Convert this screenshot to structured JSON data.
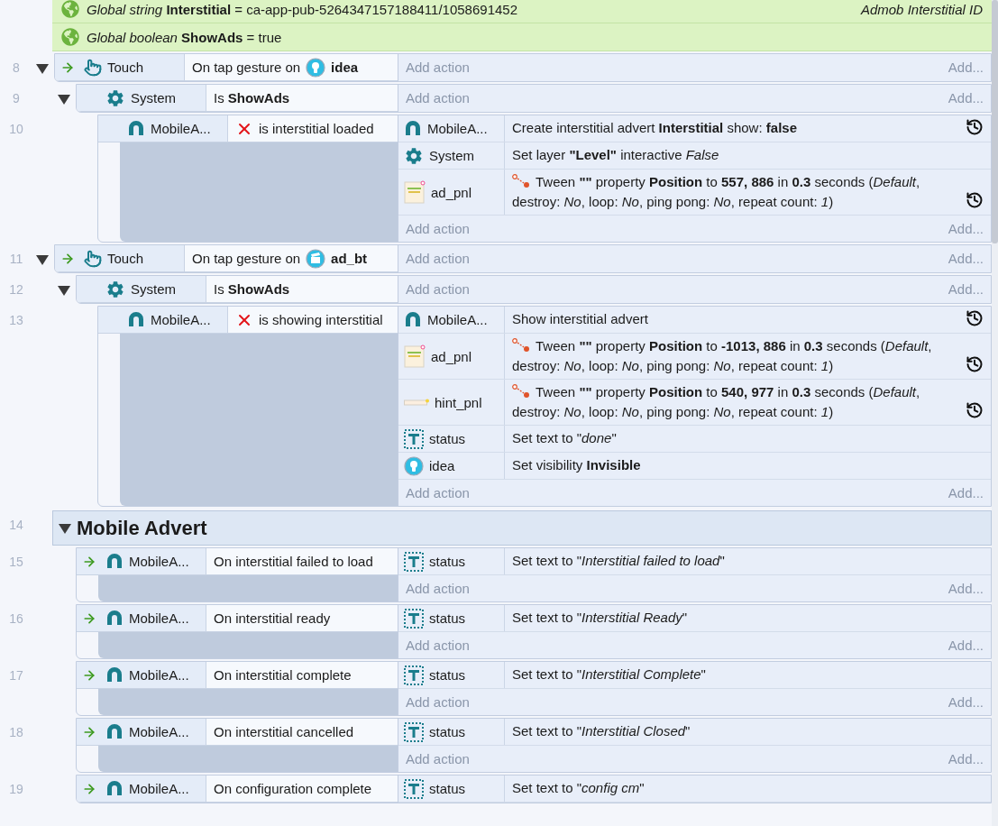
{
  "globals": [
    {
      "text": "*Global string* **Interstitial** = ca-app-pub-5264347157188411/1058691452",
      "comment": "Admob Interstitial ID"
    },
    {
      "text": "*Global boolean* **ShowAds** = true"
    }
  ],
  "sheet": [
    {
      "kind": "event",
      "number": "8",
      "expanded": true,
      "conditions": [
        {
          "trigger": true,
          "kind": "touch",
          "object": "Touch",
          "text": "On tap gesture on",
          "param": {
            "kind": "idea",
            "name": "idea"
          }
        }
      ],
      "add_action": "Add action",
      "add_more": "Add...",
      "children": [
        {
          "kind": "event",
          "number": "9",
          "expanded": true,
          "conditions": [
            {
              "trigger": false,
              "kind": "system",
              "object": "System",
              "text": "Is **ShowAds**"
            }
          ],
          "add_action": "Add action",
          "add_more": "Add...",
          "children": [
            {
              "kind": "event",
              "number": "10",
              "conditions": [
                {
                  "trigger": false,
                  "inverted": true,
                  "kind": "mobile-ads",
                  "object": "MobileA...",
                  "text": "is interstitial loaded"
                }
              ],
              "actions": [
                {
                  "kind": "mobile-ads",
                  "object": "MobileA...",
                  "tween": false,
                  "async": true,
                  "text": "Create interstitial advert **Interstitial** show: **false**"
                },
                {
                  "kind": "system",
                  "object": "System",
                  "tween": false,
                  "async": false,
                  "text": "Set layer **\"Level\"** interactive *False*"
                },
                {
                  "kind": "panel",
                  "object": "ad_pnl",
                  "tween": true,
                  "async": true,
                  "text": "Tween **\"\"** property **Position** to **557, 886** in **0.3** seconds (*Default*, destroy: *No*, loop: *No*, ping pong: *No*, repeat count: *1*)"
                }
              ],
              "add_action": "Add action",
              "add_more": "Add..."
            }
          ]
        }
      ]
    },
    {
      "kind": "event",
      "number": "11",
      "expanded": true,
      "conditions": [
        {
          "trigger": true,
          "kind": "touch",
          "object": "Touch",
          "text": "On tap gesture on",
          "param": {
            "kind": "clapper",
            "name": "ad_bt"
          }
        }
      ],
      "add_action": "Add action",
      "add_more": "Add...",
      "children": [
        {
          "kind": "event",
          "number": "12",
          "expanded": true,
          "conditions": [
            {
              "trigger": false,
              "kind": "system",
              "object": "System",
              "text": "Is **ShowAds**"
            }
          ],
          "add_action": "Add action",
          "add_more": "Add...",
          "children": [
            {
              "kind": "event",
              "number": "13",
              "conditions": [
                {
                  "trigger": false,
                  "inverted": true,
                  "kind": "mobile-ads",
                  "object": "MobileA...",
                  "text": "is showing interstitial"
                }
              ],
              "actions": [
                {
                  "kind": "mobile-ads",
                  "object": "MobileA...",
                  "tween": false,
                  "async": true,
                  "text": "Show interstitial advert"
                },
                {
                  "kind": "panel",
                  "object": "ad_pnl",
                  "tween": true,
                  "async": true,
                  "text": "Tween **\"\"** property **Position** to **-1013, 886** in **0.3** seconds (*Default*, destroy: *No*, loop: *No*, ping pong: *No*, repeat count: *1*)"
                },
                {
                  "kind": "bar",
                  "object": "hint_pnl",
                  "tween": true,
                  "async": true,
                  "text": "Tween **\"\"** property **Position** to **540, 977** in **0.3** seconds (*Default*, destroy: *No*, loop: *No*, ping pong: *No*, repeat count: *1*)"
                },
                {
                  "kind": "text",
                  "object": "status",
                  "tween": false,
                  "async": false,
                  "text": "Set text to \"*done*\""
                },
                {
                  "kind": "idea",
                  "object": "idea",
                  "tween": false,
                  "async": false,
                  "text": "Set visibility **Invisible**"
                }
              ],
              "add_action": "Add action",
              "add_more": "Add..."
            }
          ]
        }
      ]
    },
    {
      "kind": "group",
      "number": "14",
      "expanded": true,
      "title": "Mobile Advert",
      "children": [
        {
          "kind": "event",
          "number": "15",
          "conditions": [
            {
              "trigger": true,
              "kind": "mobile-ads",
              "object": "MobileA...",
              "text": "On interstitial failed to load"
            }
          ],
          "actions": [
            {
              "kind": "text",
              "object": "status",
              "text": "Set text to \"*Interstitial failed to load*\""
            }
          ],
          "add_action": "Add action",
          "add_more": "Add..."
        },
        {
          "kind": "event",
          "number": "16",
          "conditions": [
            {
              "trigger": true,
              "kind": "mobile-ads",
              "object": "MobileA...",
              "text": "On interstitial ready"
            }
          ],
          "actions": [
            {
              "kind": "text",
              "object": "status",
              "text": "Set text to \"*Interstitial Ready*\""
            }
          ],
          "add_action": "Add action",
          "add_more": "Add..."
        },
        {
          "kind": "event",
          "number": "17",
          "conditions": [
            {
              "trigger": true,
              "kind": "mobile-ads",
              "object": "MobileA...",
              "text": "On interstitial complete"
            }
          ],
          "actions": [
            {
              "kind": "text",
              "object": "status",
              "text": "Set text to \"*Interstitial Complete*\""
            }
          ],
          "add_action": "Add action",
          "add_more": "Add..."
        },
        {
          "kind": "event",
          "number": "18",
          "conditions": [
            {
              "trigger": true,
              "kind": "mobile-ads",
              "object": "MobileA...",
              "text": "On interstitial cancelled"
            }
          ],
          "actions": [
            {
              "kind": "text",
              "object": "status",
              "text": "Set text to \"*Interstitial Closed*\""
            }
          ],
          "add_action": "Add action",
          "add_more": "Add..."
        },
        {
          "kind": "event",
          "number": "19",
          "conditions": [
            {
              "trigger": true,
              "kind": "mobile-ads",
              "object": "MobileA...",
              "text": "On configuration complete"
            }
          ],
          "actions": [
            {
              "kind": "text",
              "object": "status",
              "text": "Set text to \"*config cm*\""
            }
          ]
        }
      ]
    }
  ]
}
